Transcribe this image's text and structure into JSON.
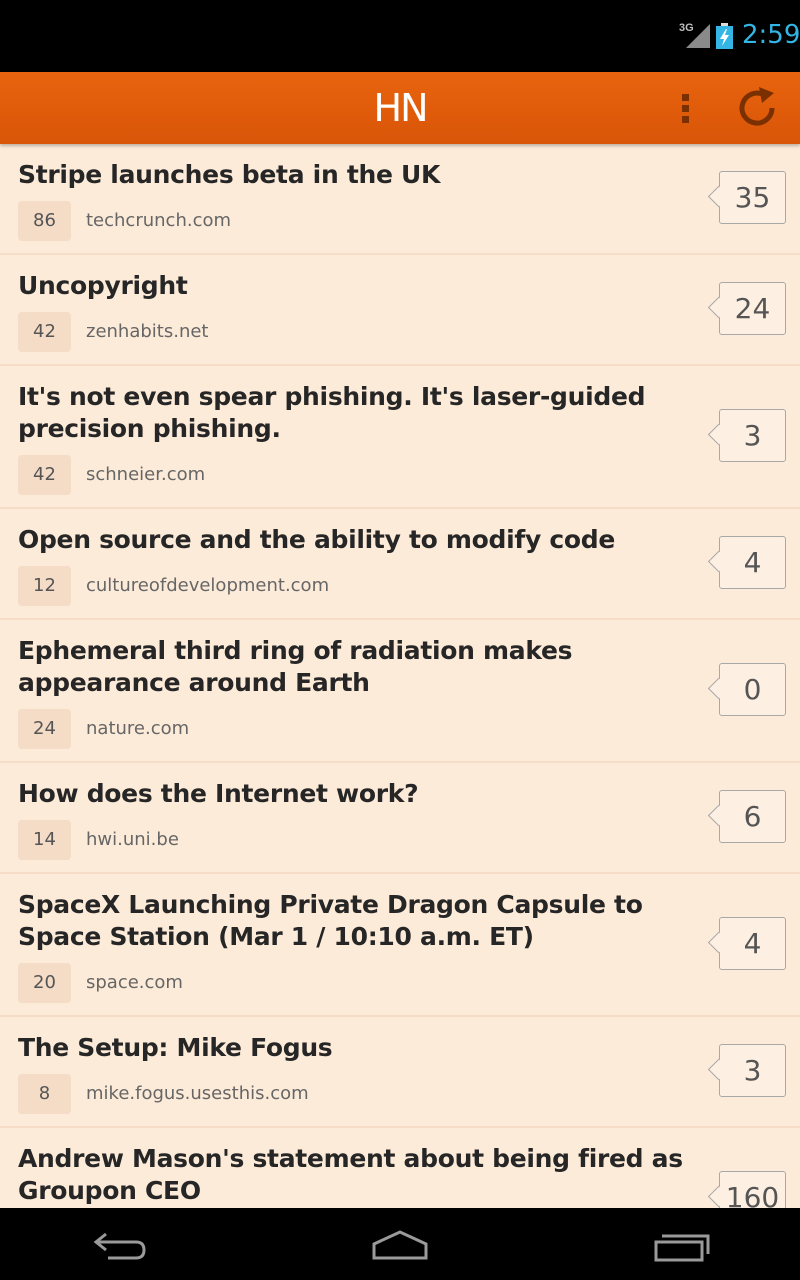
{
  "status_bar": {
    "network": "3G",
    "time": "2:59",
    "time_color": "#33b5e5"
  },
  "action_bar": {
    "title": "HN",
    "menu_icon": "overflow-menu-icon",
    "refresh_icon": "refresh-icon",
    "accent": "#e35e0b"
  },
  "stories": [
    {
      "title": "Stripe launches beta in the UK",
      "points": "86",
      "domain": "techcrunch.com",
      "comments": "35"
    },
    {
      "title": "Uncopyright",
      "points": "42",
      "domain": "zenhabits.net",
      "comments": "24"
    },
    {
      "title": "It's not even spear phishing. It's laser-guided precision phishing.",
      "points": "42",
      "domain": "schneier.com",
      "comments": "3"
    },
    {
      "title": "Open source and the ability to modify code",
      "points": "12",
      "domain": "cultureofdevelopment.com",
      "comments": "4"
    },
    {
      "title": "Ephemeral third ring of radiation makes appearance around Earth",
      "points": "24",
      "domain": "nature.com",
      "comments": "0"
    },
    {
      "title": "How does the Internet work?",
      "points": "14",
      "domain": "hwi.uni.be",
      "comments": "6"
    },
    {
      "title": "SpaceX Launching Private Dragon Capsule to Space Station (Mar 1 / 10:10 a.m. ET)",
      "points": "20",
      "domain": "space.com",
      "comments": "4"
    },
    {
      "title": "The Setup: Mike Fogus",
      "points": "8",
      "domain": "mike.fogus.usesthis.com",
      "comments": "3"
    },
    {
      "title": "Andrew Mason's statement about being fired as Groupon CEO",
      "points": "",
      "domain": "",
      "comments": "160"
    }
  ],
  "nav_bar": {
    "back_icon": "back-icon",
    "home_icon": "home-icon",
    "recents_icon": "recent-apps-icon"
  }
}
